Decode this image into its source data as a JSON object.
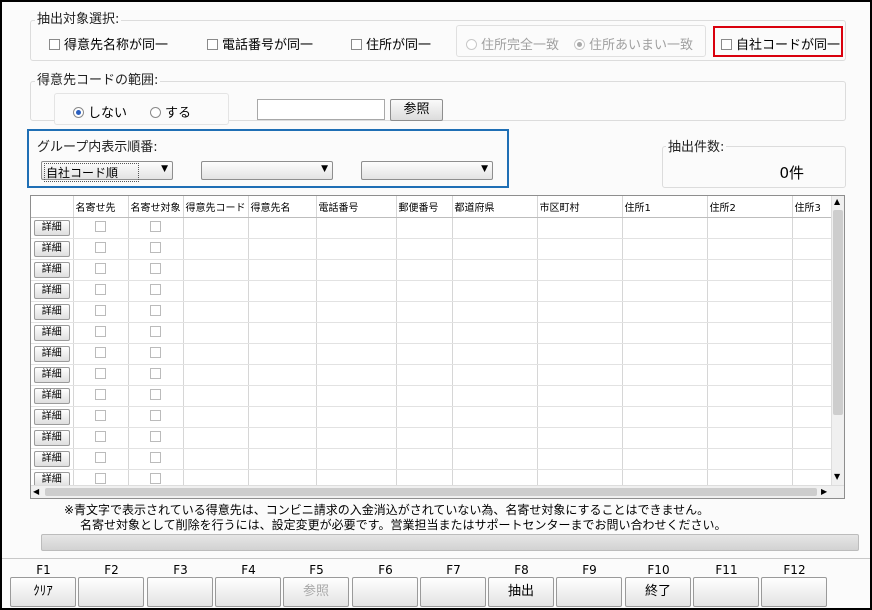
{
  "colors": {
    "red_highlight": "#d9000d",
    "blue_highlight": "#1f6fb5"
  },
  "extraction": {
    "title": "抽出対象選択:",
    "options": [
      {
        "label": "得意先名称が同一",
        "checked": false
      },
      {
        "label": "電話番号が同一",
        "checked": false
      },
      {
        "label": "住所が同一",
        "checked": false
      }
    ],
    "address_match": {
      "exact_label": "住所完全一致",
      "fuzzy_label": "住所あいまい一致",
      "selected": "fuzzy"
    },
    "own_code_label": "自社コードが同一"
  },
  "code_range": {
    "title": "得意先コードの範囲:",
    "no_label": "しない",
    "yes_label": "する",
    "selected": "no",
    "input_value": "",
    "browse_label": "参照"
  },
  "group_order": {
    "title": "グループ内表示順番:",
    "select1": "自社コード順",
    "select2": "",
    "select3": ""
  },
  "count": {
    "title": "抽出件数:",
    "value": "0件"
  },
  "grid": {
    "columns": [
      "",
      "名寄せ先",
      "名寄せ対象",
      "得意先コード",
      "得意先名",
      "電話番号",
      "郵便番号",
      "都道府県",
      "市区町村",
      "住所1",
      "住所2",
      "住所3"
    ],
    "detail_label": "詳細",
    "row_count": 13
  },
  "notes": {
    "line1": "※青文字で表示されている得意先は、コンビニ請求の入金消込がされていない為、名寄せ対象にすることはできません。",
    "line2": "名寄せ対象として削除を行うには、設定変更が必要です。営業担当またはサポートセンターまでお問い合わせください。"
  },
  "progress": 0,
  "function_keys": [
    {
      "key": "F1",
      "label": "ｸﾘｱ",
      "enabled": true
    },
    {
      "key": "F2",
      "label": "",
      "enabled": true
    },
    {
      "key": "F3",
      "label": "",
      "enabled": true
    },
    {
      "key": "F4",
      "label": "",
      "enabled": true
    },
    {
      "key": "F5",
      "label": "参照",
      "enabled": false
    },
    {
      "key": "F6",
      "label": "",
      "enabled": true
    },
    {
      "key": "F7",
      "label": "",
      "enabled": true
    },
    {
      "key": "F8",
      "label": "抽出",
      "enabled": true
    },
    {
      "key": "F9",
      "label": "",
      "enabled": true
    },
    {
      "key": "F10",
      "label": "終了",
      "enabled": true
    },
    {
      "key": "F11",
      "label": "",
      "enabled": true
    },
    {
      "key": "F12",
      "label": "",
      "enabled": true
    }
  ]
}
